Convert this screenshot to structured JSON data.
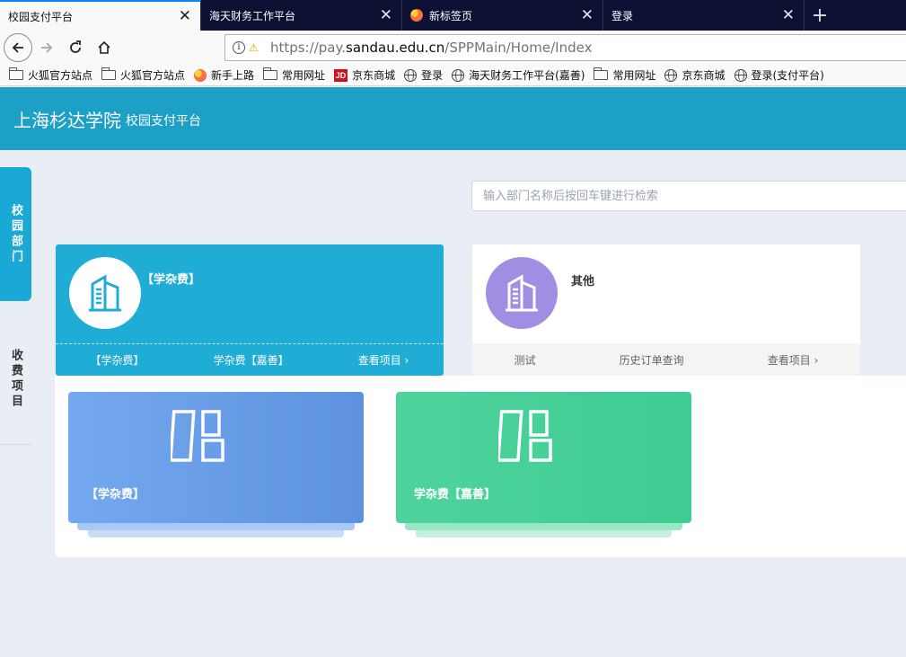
{
  "browser": {
    "tabs": [
      {
        "title": "校园支付平台",
        "active": true
      },
      {
        "title": "海天财务工作平台",
        "active": false
      },
      {
        "title": "新标签页",
        "active": false
      },
      {
        "title": "登录",
        "active": false
      }
    ],
    "new_tab": "+",
    "url": {
      "prefix": "https://pay.",
      "host": "sandau.edu.cn",
      "path": "/SPPMain/Home/Index"
    },
    "bookmarks": [
      {
        "label": "火狐官方站点",
        "icon": "folder-icon"
      },
      {
        "label": "火狐官方站点",
        "icon": "folder-icon"
      },
      {
        "label": "新手上路",
        "icon": "firefox-icon"
      },
      {
        "label": "常用网址",
        "icon": "folder-icon"
      },
      {
        "label": "京东商城",
        "icon": "jd-icon"
      },
      {
        "label": "登录",
        "icon": "globe-icon"
      },
      {
        "label": "海天财务工作平台(嘉善)",
        "icon": "globe-icon"
      },
      {
        "label": "常用网址",
        "icon": "folder-icon"
      },
      {
        "label": "京东商城",
        "icon": "globe-icon"
      },
      {
        "label": "登录(支付平台)",
        "icon": "globe-icon"
      }
    ]
  },
  "header": {
    "school": "上海杉达学院",
    "platform": "校园支付平台"
  },
  "sidebar": {
    "departments_tab": "校园部门",
    "items_tab": "收费项目"
  },
  "search": {
    "placeholder": "输入部门名称后按回车键进行检索"
  },
  "departments": [
    {
      "name": "【学杂费】",
      "links": [
        "【学杂费】",
        "学杂费【嘉善】"
      ],
      "more": "查看项目",
      "color": "#1fadd5"
    },
    {
      "name": "其他",
      "links": [
        "测试",
        "历史订单查询"
      ],
      "more": "查看项目",
      "color": "#a18ee2"
    }
  ],
  "fee_items": [
    {
      "title": "【学杂费】",
      "color": "#6b9fe8"
    },
    {
      "title": "学杂费【嘉善】",
      "color": "#47d09a"
    }
  ]
}
